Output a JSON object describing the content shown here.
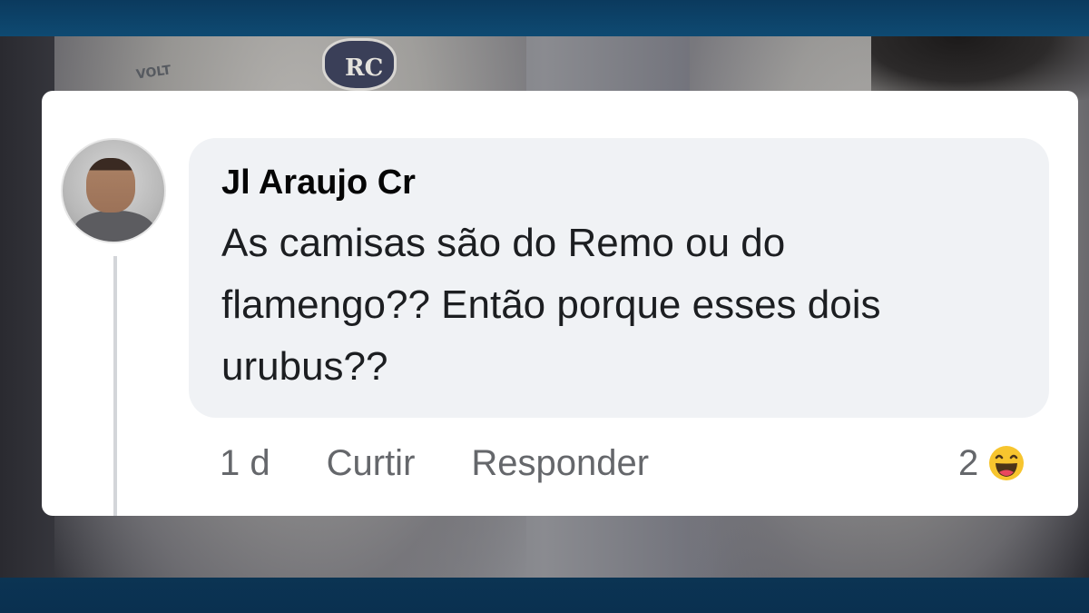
{
  "comment": {
    "author": "Jl Araujo Cr",
    "text": "As camisas são do Remo ou do flamengo?? Então porque esses dois urubus??",
    "time": "1 d",
    "like_label": "Curtir",
    "reply_label": "Responder",
    "reaction_count": "2",
    "reaction_icon": "haha-emoji-icon"
  }
}
